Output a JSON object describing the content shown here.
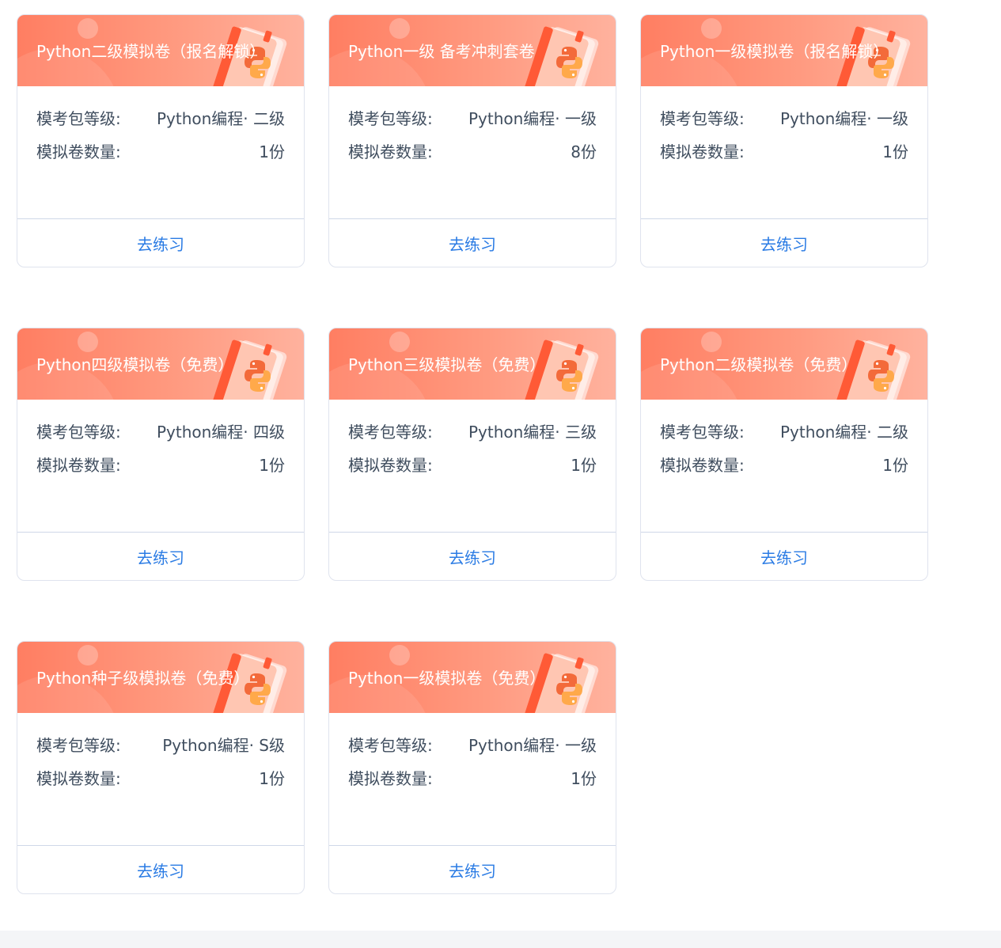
{
  "cards": [
    {
      "title": "Python二级模拟卷（报名解锁）",
      "level_label": "模考包等级:",
      "level_value": "Python编程· 二级",
      "count_label": "模拟卷数量:",
      "count_value": "1份",
      "button_label": "去练习"
    },
    {
      "title": "Python一级 备考冲刺套卷",
      "level_label": "模考包等级:",
      "level_value": "Python编程· 一级",
      "count_label": "模拟卷数量:",
      "count_value": "8份",
      "button_label": "去练习"
    },
    {
      "title": "Python一级模拟卷（报名解锁）",
      "level_label": "模考包等级:",
      "level_value": "Python编程· 一级",
      "count_label": "模拟卷数量:",
      "count_value": "1份",
      "button_label": "去练习"
    },
    {
      "title": "Python四级模拟卷（免费）",
      "level_label": "模考包等级:",
      "level_value": "Python编程· 四级",
      "count_label": "模拟卷数量:",
      "count_value": "1份",
      "button_label": "去练习"
    },
    {
      "title": "Python三级模拟卷（免费）",
      "level_label": "模考包等级:",
      "level_value": "Python编程· 三级",
      "count_label": "模拟卷数量:",
      "count_value": "1份",
      "button_label": "去练习"
    },
    {
      "title": "Python二级模拟卷（免费）",
      "level_label": "模考包等级:",
      "level_value": "Python编程· 二级",
      "count_label": "模拟卷数量:",
      "count_value": "1份",
      "button_label": "去练习"
    },
    {
      "title": "Python种子级模拟卷（免费）",
      "level_label": "模考包等级:",
      "level_value": "Python编程· S级",
      "count_label": "模拟卷数量:",
      "count_value": "1份",
      "button_label": "去练习"
    },
    {
      "title": "Python一级模拟卷（免费）",
      "level_label": "模考包等级:",
      "level_value": "Python编程· 一级",
      "count_label": "模拟卷数量:",
      "count_value": "1份",
      "button_label": "去练习"
    }
  ],
  "theme": {
    "header_gradient_start": "#ff7e62",
    "header_gradient_end": "#ffb29e",
    "link_color": "#2a7be4",
    "text_color": "#3f4d5e",
    "book_icon": "python-book-icon"
  }
}
